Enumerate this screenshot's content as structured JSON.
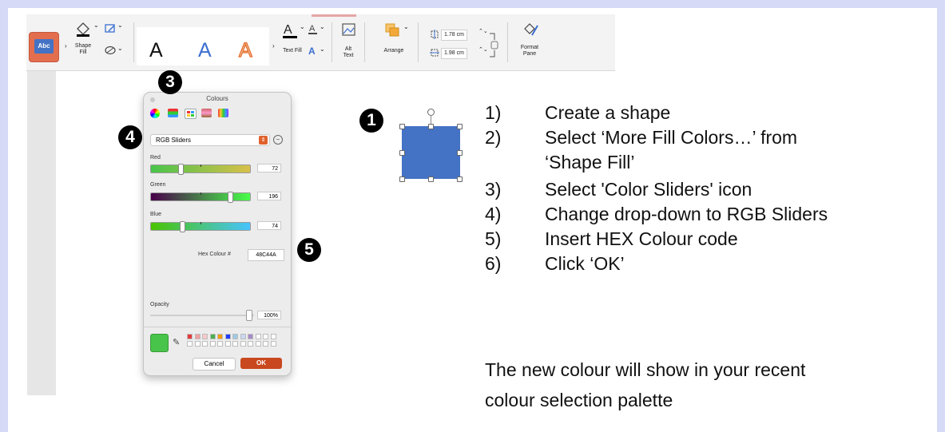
{
  "ribbon": {
    "shape_style_label": "Abc",
    "shape_fill_label": "Shape\nFill",
    "wordart_letters": [
      "A",
      "A",
      "A"
    ],
    "text_fill_label": "Text Fill",
    "alt_text_label": "Alt\nText",
    "arrange_label": "Arrange",
    "height_value": "1.78 cm",
    "width_value": "1.98 cm",
    "format_pane_label": "Format\nPane"
  },
  "dialog": {
    "title": "Colours",
    "mode_dropdown": "RGB Sliders",
    "red_label": "Red",
    "red_value": "72",
    "green_label": "Green",
    "green_value": "196",
    "blue_label": "Blue",
    "blue_value": "74",
    "hex_label": "Hex Colour #",
    "hex_value": "48C44A",
    "opacity_label": "Opacity",
    "opacity_value": "100%",
    "cancel_label": "Cancel",
    "ok_label": "OK",
    "current_color": "#48c44a",
    "palette_colors": [
      "#e23b3b",
      "#f0a1a1",
      "#f7c9c9",
      "#4caf50",
      "#f39c12",
      "#1f3cff",
      "#9ecae1",
      "#c7d8f0",
      "#a58bc9"
    ]
  },
  "callouts": {
    "c1": "1",
    "c3": "3",
    "c4": "4",
    "c5": "5"
  },
  "steps": [
    {
      "num": "1)",
      "text": "Create a shape"
    },
    {
      "num": "2)",
      "text": "Select ‘More Fill Colors…’ from"
    },
    {
      "num": "",
      "text": "‘Shape Fill’"
    },
    {
      "num": "3)",
      "text": "Select 'Color Sliders' icon"
    },
    {
      "num": "4)",
      "text": "Change drop-down to RGB Sliders"
    },
    {
      "num": "5)",
      "text": "Insert HEX Colour code"
    },
    {
      "num": "6)",
      "text": "Click ‘OK’"
    }
  ],
  "note": {
    "line1": "The new colour will show in your recent",
    "line2": "colour selection palette"
  },
  "colors": {
    "background": "#d6daf6",
    "shape_fill": "#4472c4",
    "accent_orange": "#c9481f"
  }
}
